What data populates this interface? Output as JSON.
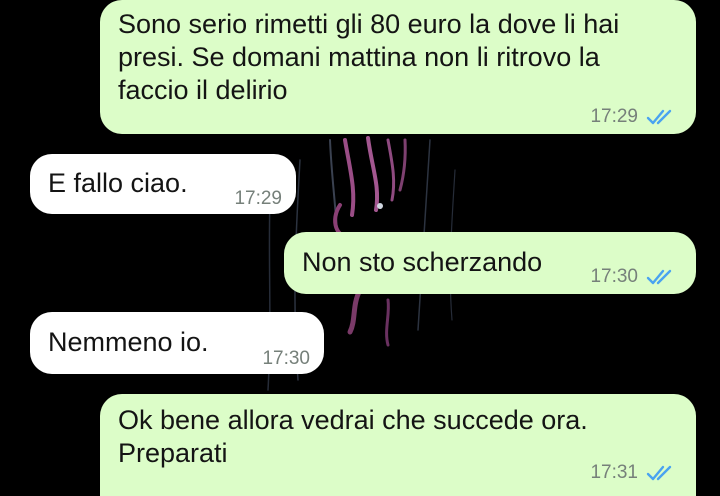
{
  "colors": {
    "outgoing_bubble": "#dcfdc8",
    "incoming_bubble": "#ffffff",
    "chat_background": "#000000",
    "read_ticks": "#4aa3f0",
    "timestamp": "#76807a"
  },
  "messages": [
    {
      "direction": "outgoing",
      "text": "Sono serio rimetti gli 80 euro la dove li hai\npresi. Se domani mattina non li ritrovo la\nfaccio il delirio",
      "time": "17:29",
      "status_icon": "double-check-read-icon"
    },
    {
      "direction": "incoming",
      "text": "E fallo ciao.",
      "time": "17:29"
    },
    {
      "direction": "outgoing",
      "text": "Non sto scherzando",
      "time": "17:30",
      "status_icon": "double-check-read-icon"
    },
    {
      "direction": "incoming",
      "text": "Nemmeno io.",
      "time": "17:30"
    },
    {
      "direction": "outgoing",
      "text": "Ok bene allora vedrai che succede ora.\nPreparati",
      "time": "17:31",
      "status_icon": "double-check-read-icon"
    }
  ]
}
